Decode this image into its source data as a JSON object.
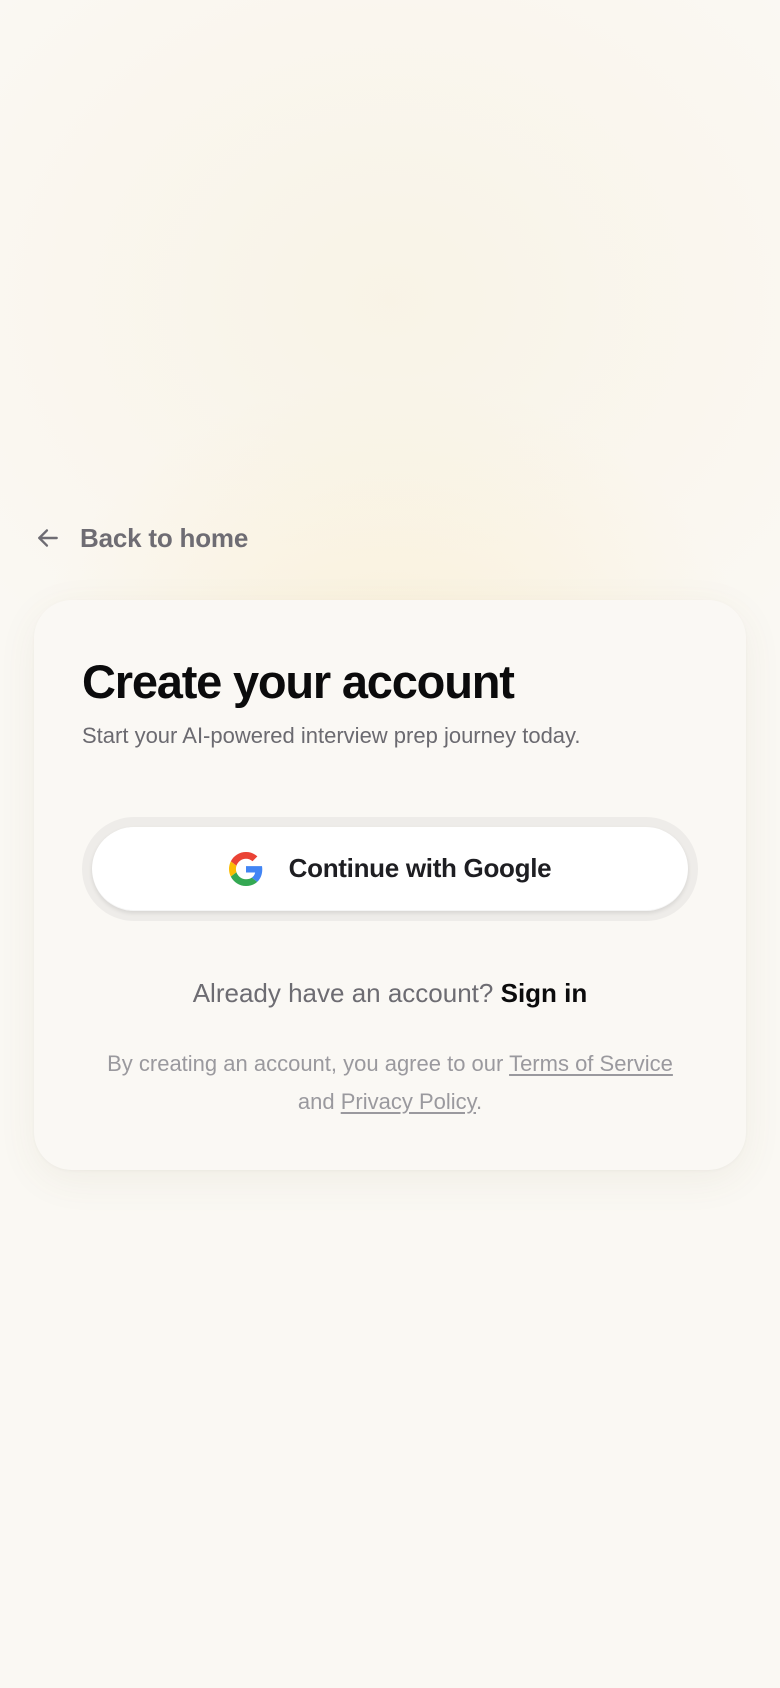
{
  "back_link": {
    "label": "Back to home",
    "icon": "arrow-left-icon"
  },
  "card": {
    "title": "Create your account",
    "subtitle": "Start your AI-powered interview prep journey today.",
    "google_button": {
      "label": "Continue with Google",
      "icon": "google-logo-icon"
    },
    "signin": {
      "prompt": "Already have an account?",
      "link_label": "Sign in"
    },
    "legal": {
      "prefix": "By creating an account, you agree to our",
      "terms_label": "Terms of Service",
      "conjunction": "and",
      "privacy_label": "Privacy Policy",
      "suffix": "."
    }
  },
  "colors": {
    "background": "#faf8f3",
    "card_background": "#faf8f4",
    "title_text": "#0b0b0c",
    "muted_text": "#6b6a70",
    "legal_text": "#9a999e",
    "google_blue": "#4285F4",
    "google_red": "#EA4335",
    "google_yellow": "#FBBC05",
    "google_green": "#34A853"
  }
}
